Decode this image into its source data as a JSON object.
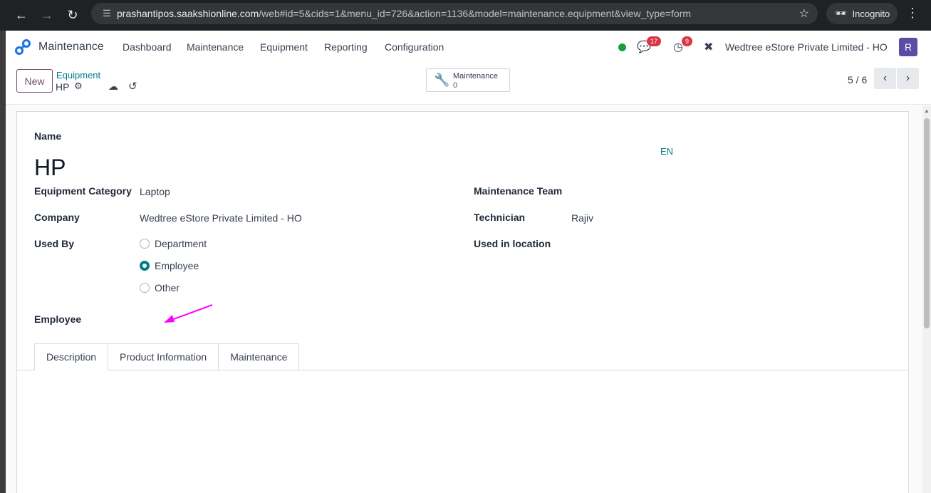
{
  "browser": {
    "url_host": "prashantipos.saakshionline.com",
    "url_path": "/web#id=5&cids=1&menu_id=726&action=1136&model=maintenance.equipment&view_type=form",
    "incognito_label": "Incognito"
  },
  "topnav": {
    "app_name": "Maintenance",
    "menu": [
      "Dashboard",
      "Maintenance",
      "Equipment",
      "Reporting",
      "Configuration"
    ],
    "chat_count": "17",
    "activity_count": "9",
    "company": "Wedtree eStore Private Limited - HO",
    "avatar_letter": "R"
  },
  "control": {
    "new_label": "New",
    "breadcrumb_parent": "Equipment",
    "breadcrumb_current": "HP",
    "smart_button_label": "Maintenance",
    "smart_button_value": "0",
    "pager": "5 / 6"
  },
  "form": {
    "name_label": "Name",
    "name_value": "HP",
    "lang": "EN",
    "category_label": "Equipment Category",
    "category_value": "Laptop",
    "company_label": "Company",
    "company_value": "Wedtree eStore Private Limited - HO",
    "used_by_label": "Used By",
    "used_by_options": [
      "Department",
      "Employee",
      "Other"
    ],
    "used_by_selected": "Employee",
    "employee_label": "Employee",
    "team_label": "Maintenance Team",
    "technician_label": "Technician",
    "technician_value": "Rajiv",
    "location_label": "Used in location"
  },
  "tabs": [
    "Description",
    "Product Information",
    "Maintenance"
  ],
  "colors": {
    "brand": "#714b67",
    "accent": "#017e84",
    "annotation_arrow": "#ff00ff"
  }
}
